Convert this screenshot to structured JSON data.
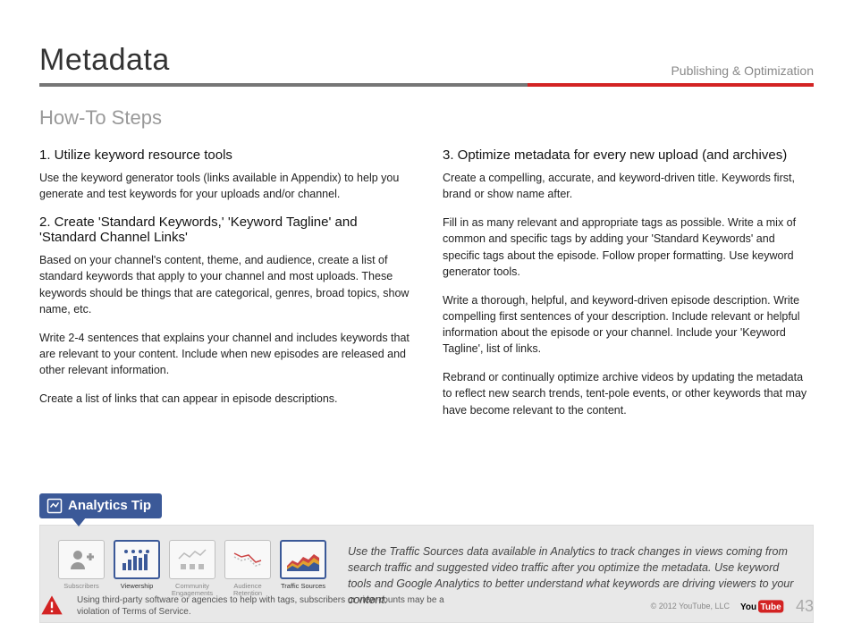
{
  "header": {
    "title": "Metadata",
    "breadcrumb": "Publishing & Optimization"
  },
  "section_title": "How-To Steps",
  "left": {
    "step1_title": "1. Utilize keyword resource tools",
    "step1_body": "Use the keyword generator tools (links available in Appendix) to help you generate and test keywords for your uploads and/or channel.",
    "step2_title": "2. Create 'Standard Keywords,' 'Keyword Tagline' and 'Standard Channel Links'",
    "step2_body1": "Based on your channel's content, theme, and audience, create a list of standard keywords that apply to your channel and most uploads. These keywords should be things that are categorical, genres, broad topics, show name, etc.",
    "step2_body2": "Write 2-4 sentences that explains your channel and includes keywords that are relevant to your content. Include when new episodes are released and other relevant information.",
    "step2_body3": "Create a list of links that can appear in episode descriptions."
  },
  "right": {
    "step3_title": "3. Optimize metadata for every new upload (and archives)",
    "step3_body1": "Create a compelling, accurate, and keyword-driven title. Keywords first, brand or show name after.",
    "step3_body2": "Fill in as many relevant and appropriate tags as possible. Write a mix of common and specific tags by adding your 'Standard Keywords' and specific tags about the episode. Follow proper formatting. Use keyword generator tools.",
    "step3_body3": "Write a thorough, helpful, and keyword-driven episode description. Write compelling first sentences of your description. Include relevant or helpful information about the episode or your channel. Include your 'Keyword Tagline', list of links.",
    "step3_body4": "Rebrand or continually optimize archive videos by updating the metadata to reflect new search trends, tent-pole events, or other keywords that may have become relevant to the content."
  },
  "tip": {
    "badge": "Analytics Tip",
    "icons": {
      "subscribers": "Subscribers",
      "viewership": "Viewership",
      "community": "Community Engagements",
      "retention": "Audience Retention",
      "traffic": "Traffic Sources"
    },
    "text": "Use the Traffic Sources data available in Analytics to track changes in views coming from search traffic and suggested video traffic after you optimize the metadata.  Use keyword tools and Google Analytics to better understand what keywords are driving viewers to your content."
  },
  "footer": {
    "warning": "Using third-party software or agencies to help with tags, subscribers or view counts may be a violation of Terms of Service.",
    "copyright": "© 2012 YouTube, LLC",
    "page_num": "43"
  }
}
